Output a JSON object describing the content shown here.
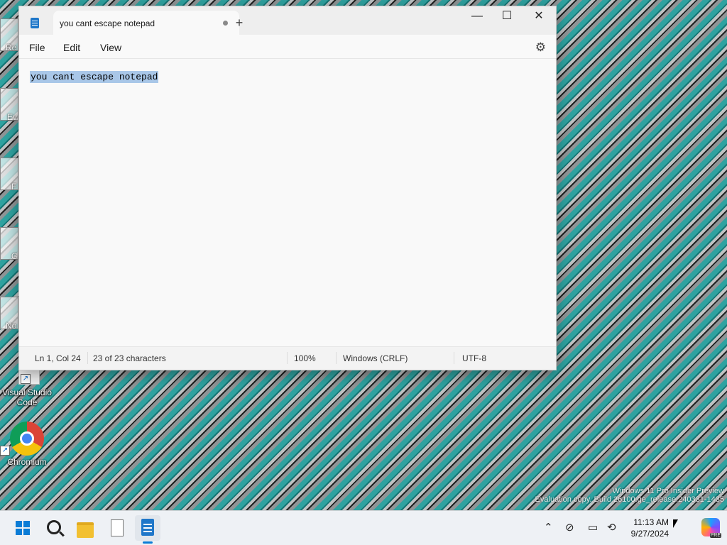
{
  "desktop": {
    "icons": [
      {
        "label": "Visual Studio Code",
        "icon": "vscode-icon"
      },
      {
        "label": "Chromium",
        "icon": "chromium-icon"
      }
    ],
    "partial_labels": [
      "Re",
      "Ev",
      "F",
      "G",
      "No"
    ],
    "watermark": {
      "line1": "Windows 11 Pro Insider Preview",
      "line2": "Evaluation copy. Build 26100.ge_release.240331-1435"
    }
  },
  "notepad": {
    "tab_title": "you cant escape notepad",
    "menu": [
      "File",
      "Edit",
      "View"
    ],
    "content": "you cant escape notepad",
    "status": {
      "position": "Ln 1, Col 24",
      "characters": "23 of 23 characters",
      "zoom": "100%",
      "line_ending": "Windows (CRLF)",
      "encoding": "UTF-8"
    },
    "controls": {
      "minimize": "—",
      "maximize": "☐",
      "close": "✕",
      "new_tab": "+",
      "settings": "⚙"
    }
  },
  "taskbar": {
    "clock": {
      "time": "11:13 AM",
      "date": "9/27/2024"
    },
    "tray_icons": [
      "chevron-up-icon",
      "network-icon",
      "display-icon",
      "sync-icon"
    ],
    "tray_glyphs": {
      "chevron": "⌃",
      "network": "⊘",
      "display": "▭",
      "sync": "⟲"
    },
    "copilot_badge": "PRE"
  },
  "colors": {
    "accent": "#0a7cd6",
    "selection": "#a9c7e8"
  }
}
